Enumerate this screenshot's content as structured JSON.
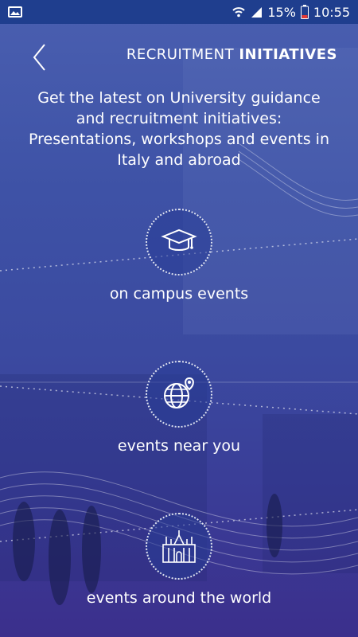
{
  "status_bar": {
    "battery": "15%",
    "time": "10:55",
    "icons": [
      "gallery-icon",
      "wifi-icon",
      "signal-icon",
      "battery-icon"
    ]
  },
  "header": {
    "title_regular": "RECRUITMENT ",
    "title_bold": "INITIATIVES",
    "back_icon": "chevron-left-icon"
  },
  "intro_text": "Get the latest on University guidance and recruitment initiatives: Presentations, workshops and events in Italy and abroad",
  "items": [
    {
      "label": "on campus events",
      "icon": "graduation-cap-icon"
    },
    {
      "label": "events near you",
      "icon": "globe-pin-icon"
    },
    {
      "label": "events around the world",
      "icon": "cathedral-icon"
    }
  ],
  "colors": {
    "background_top": "#4a5fb0",
    "background_bottom": "#3b2f8c",
    "status_bar": "#1f3e8e",
    "text": "#ffffff"
  }
}
